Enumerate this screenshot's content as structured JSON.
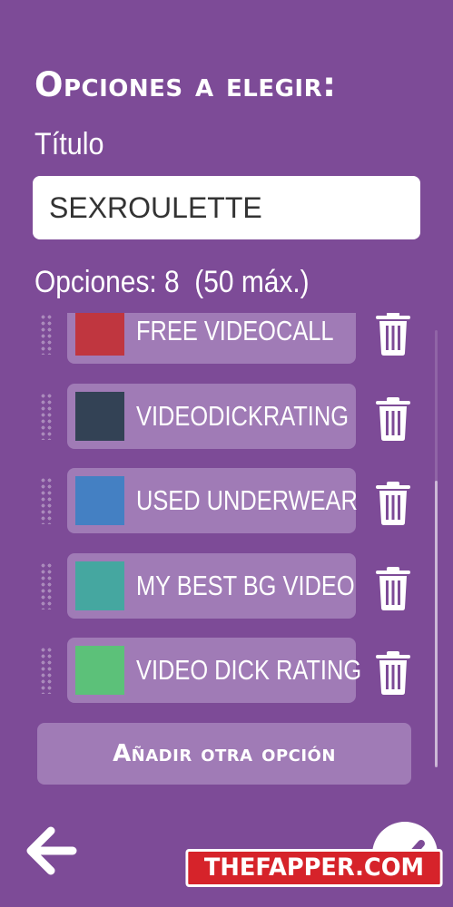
{
  "header": {
    "title": "Opciones a elegir:"
  },
  "form": {
    "title_label": "Título",
    "title_value": "SEXROULETTE",
    "options_count": "Opciones: 8  (50 máx.)"
  },
  "options": [
    {
      "label": "FREE VIDEOCALL",
      "color": "#c0363f"
    },
    {
      "label": "VIDEODICKRATING",
      "color": "#334255"
    },
    {
      "label": "USED UNDERWEAR",
      "color": "#4480c3"
    },
    {
      "label": "MY BEST BG VIDEO",
      "color": "#45a7a0"
    },
    {
      "label": "VIDEO DICK RATING",
      "color": "#5cc179"
    }
  ],
  "icons": {
    "delete": "trash-icon",
    "drag": "drag-handle-icon",
    "back": "arrow-left-icon",
    "confirm": "check-icon"
  },
  "actions": {
    "add_option": "Añadir otra opción"
  },
  "watermark": "THEFAPPER.COM",
  "colors": {
    "background": "#7d4b97",
    "card": "#a07bb6"
  }
}
